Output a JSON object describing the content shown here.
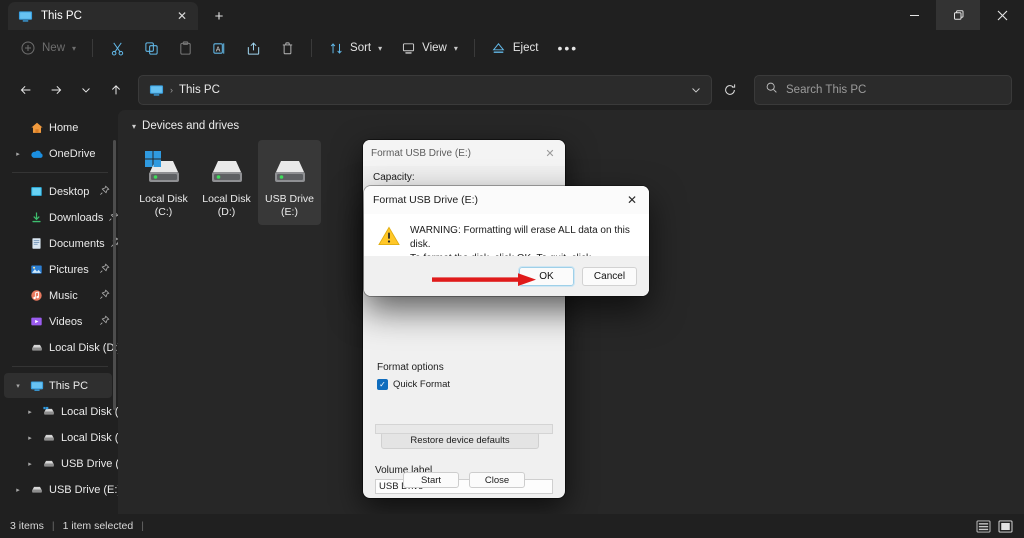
{
  "window": {
    "tab_title": "This PC",
    "tab_icon": "this-pc-icon",
    "new_tab_label": "+",
    "controls": {
      "minimize": "–",
      "restore": "❐",
      "close": "✕"
    }
  },
  "toolbar": {
    "new_label": "New",
    "items": [
      {
        "name": "cut",
        "icon": "scissors-icon"
      },
      {
        "name": "copy",
        "icon": "copy-icon"
      },
      {
        "name": "paste",
        "icon": "paste-icon"
      },
      {
        "name": "rename",
        "icon": "rename-icon"
      },
      {
        "name": "share",
        "icon": "share-icon"
      },
      {
        "name": "delete",
        "icon": "trash-icon"
      }
    ],
    "sort_label": "Sort",
    "view_label": "View",
    "eject_label": "Eject",
    "more_label": "•••"
  },
  "addressbar": {
    "back": "←",
    "forward": "→",
    "recent": "⌄",
    "up": "↑",
    "breadcrumb_icon": "this-pc-icon",
    "breadcrumb_sep": "›",
    "breadcrumb_text": "This PC",
    "refresh": "⟳",
    "search_placeholder": "Search This PC"
  },
  "sidebar": {
    "items": [
      {
        "label": "Home",
        "icon": "home-icon",
        "expand": "",
        "pin": "",
        "selected": false
      },
      {
        "label": "OneDrive",
        "icon": "onedrive-icon",
        "expand": "›",
        "pin": "",
        "selected": false
      },
      {
        "divider": true
      },
      {
        "label": "Desktop",
        "icon": "desktop-icon",
        "expand": "",
        "pin": "📌",
        "selected": false
      },
      {
        "label": "Downloads",
        "icon": "downloads-icon",
        "expand": "",
        "pin": "📌",
        "selected": false
      },
      {
        "label": "Documents",
        "icon": "documents-icon",
        "expand": "",
        "pin": "📌",
        "selected": false
      },
      {
        "label": "Pictures",
        "icon": "pictures-icon",
        "expand": "",
        "pin": "📌",
        "selected": false
      },
      {
        "label": "Music",
        "icon": "music-icon",
        "expand": "",
        "pin": "📌",
        "selected": false
      },
      {
        "label": "Videos",
        "icon": "videos-icon",
        "expand": "",
        "pin": "📌",
        "selected": false
      },
      {
        "label": "Local Disk (D:)",
        "icon": "drive-icon",
        "expand": "",
        "pin": "",
        "selected": false
      },
      {
        "divider": true
      },
      {
        "label": "This PC",
        "icon": "this-pc-icon",
        "expand": "⌄",
        "pin": "",
        "selected": true
      },
      {
        "label": "Local Disk (C:)",
        "icon": "windows-drive-icon",
        "expand": "›",
        "pin": "",
        "selected": false,
        "indent": true
      },
      {
        "label": "Local Disk (D:)",
        "icon": "drive-icon",
        "expand": "›",
        "pin": "",
        "selected": false,
        "indent": true
      },
      {
        "label": "USB Drive (E:)",
        "icon": "drive-icon",
        "expand": "›",
        "pin": "",
        "selected": false,
        "indent": true
      },
      {
        "label": "USB Drive (E:)",
        "icon": "drive-icon",
        "expand": "›",
        "pin": "",
        "selected": false
      }
    ]
  },
  "content": {
    "group_title": "Devices and drives",
    "group_caret": "⌄",
    "drives": [
      {
        "line1": "Local Disk",
        "line2": "(C:)",
        "icon": "windows-drive-icon",
        "selected": false
      },
      {
        "line1": "Local Disk",
        "line2": "(D:)",
        "icon": "drive-icon",
        "selected": false
      },
      {
        "line1": "USB Drive",
        "line2": "(E:)",
        "icon": "drive-icon",
        "selected": true
      }
    ]
  },
  "format_dialog": {
    "title": "Format USB Drive (E:)",
    "close": "✕",
    "capacity_label": "Capacity:",
    "restore_defaults_label": "Restore device defaults",
    "volume_label_caption": "Volume label",
    "volume_label_value": "USB Drive",
    "format_options_title": "Format options",
    "quick_format_label": "Quick Format",
    "quick_format_checked": true,
    "check_glyph": "✓",
    "start_label": "Start",
    "close_label": "Close"
  },
  "warning_dialog": {
    "title": "Format USB Drive (E:)",
    "close": "✕",
    "icon": "warning-triangle-icon",
    "message_line1": "WARNING: Formatting will erase ALL data on this disk.",
    "message_line2": "To format the disk, click OK. To quit, click CANCEL.",
    "ok_label": "OK",
    "cancel_label": "Cancel",
    "annotation_arrow": "red-arrow-pointing-to-ok"
  },
  "statusbar": {
    "item_count": "3 items",
    "separator": "|",
    "selection": "1 item selected",
    "separator2": "|",
    "details_view_icon": "details-view-icon",
    "large_icons_view_icon": "large-icons-view-icon"
  },
  "colors": {
    "window_bg": "#202020",
    "content_bg": "#272727",
    "accent": "#0f6cbd",
    "annotation_red": "#e01b1b",
    "selection_bg": "#383838"
  }
}
